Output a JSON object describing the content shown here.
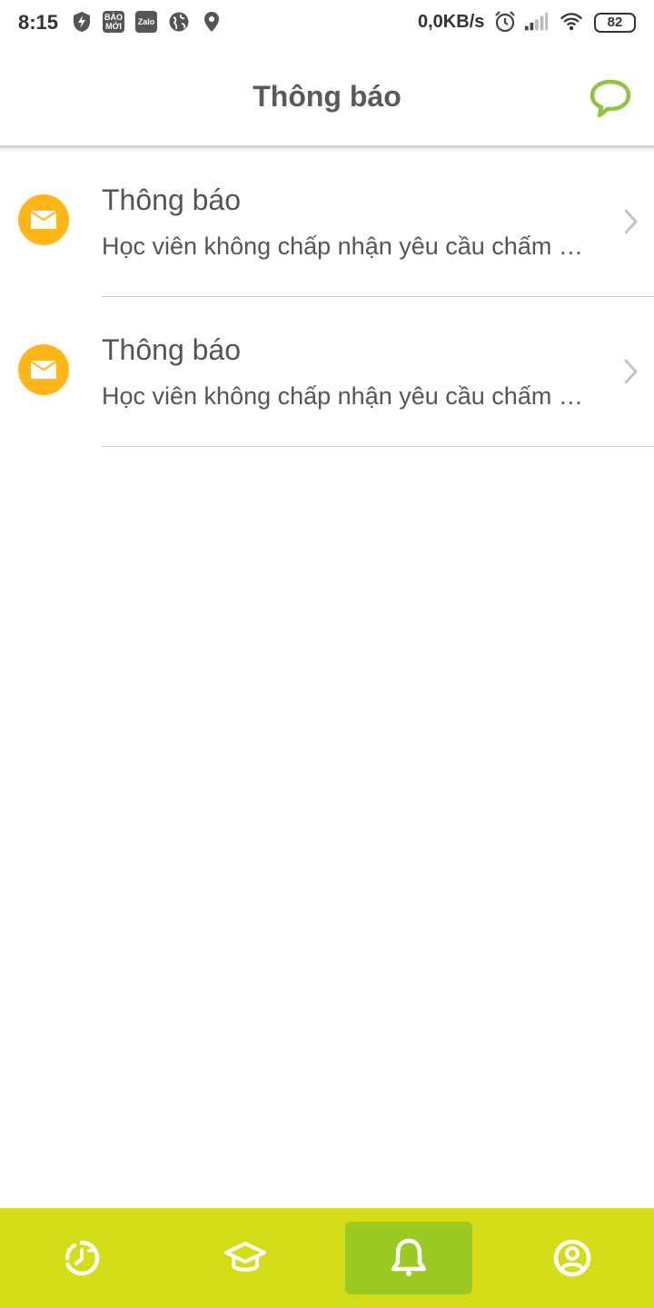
{
  "status_bar": {
    "time": "8:15",
    "notification_icons": [
      "shield-bolt-icon",
      "bao-moi-app-icon",
      "zalo-app-icon",
      "globe-icon",
      "location-pin-icon"
    ],
    "bao_moi_label_1": "BÁO",
    "bao_moi_label_2": "MỚI",
    "zalo_label": "Zalo",
    "network_speed": "0,0KB/s",
    "system_icons": [
      "alarm-icon",
      "signal-icon",
      "wifi-icon"
    ],
    "battery": "82"
  },
  "header": {
    "title": "Thông báo",
    "action_icon": "chat-bubble-icon"
  },
  "notifications": [
    {
      "icon": "envelope-icon",
      "title": "Thông báo",
      "body": "Học viên không chấp nhận yêu cầu chấm công"
    },
    {
      "icon": "envelope-icon",
      "title": "Thông báo",
      "body": "Học viên không chấp nhận yêu cầu chấm công"
    }
  ],
  "bottom_nav": {
    "items": [
      {
        "icon": "clock-history-icon",
        "active": false
      },
      {
        "icon": "graduation-cap-icon",
        "active": false
      },
      {
        "icon": "bell-icon",
        "active": true
      },
      {
        "icon": "user-profile-icon",
        "active": false
      }
    ]
  },
  "colors": {
    "accent_green": "#8cc63f",
    "nav_bar": "#d4dd18",
    "nav_active": "#9dc923",
    "avatar_orange": "#ffb619"
  }
}
